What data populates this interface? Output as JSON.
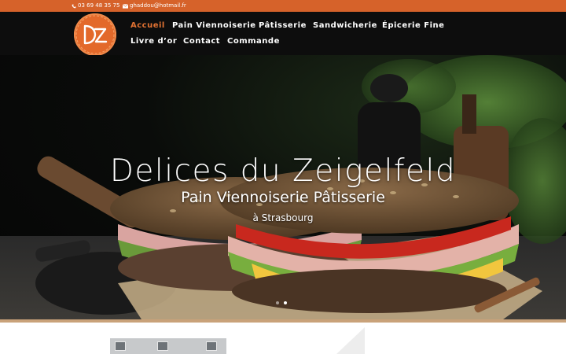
{
  "topbar": {
    "phone": "03 69 48 35 75",
    "email": "ghaddou@hotmail.fr",
    "background": "#d6622a"
  },
  "logo": {
    "text": "DZ",
    "color": "#e3692a"
  },
  "nav": {
    "items": [
      {
        "label": "Accueil",
        "active": true
      },
      {
        "label": "Pain Viennoiserie"
      },
      {
        "label": "Pâtisserie"
      },
      {
        "label": "Sandwicherie"
      },
      {
        "label": "Épicerie Fine"
      },
      {
        "label": "Livre d’or"
      },
      {
        "label": "Contact"
      },
      {
        "label": "Commande"
      }
    ],
    "active_color": "#e07132"
  },
  "hero": {
    "title": "Delices du Zeigelfeld",
    "subtitle": "Pain Viennoiserie Pâtisserie",
    "location": "à Strasbourg",
    "slides": 2,
    "active_slide": 2
  }
}
